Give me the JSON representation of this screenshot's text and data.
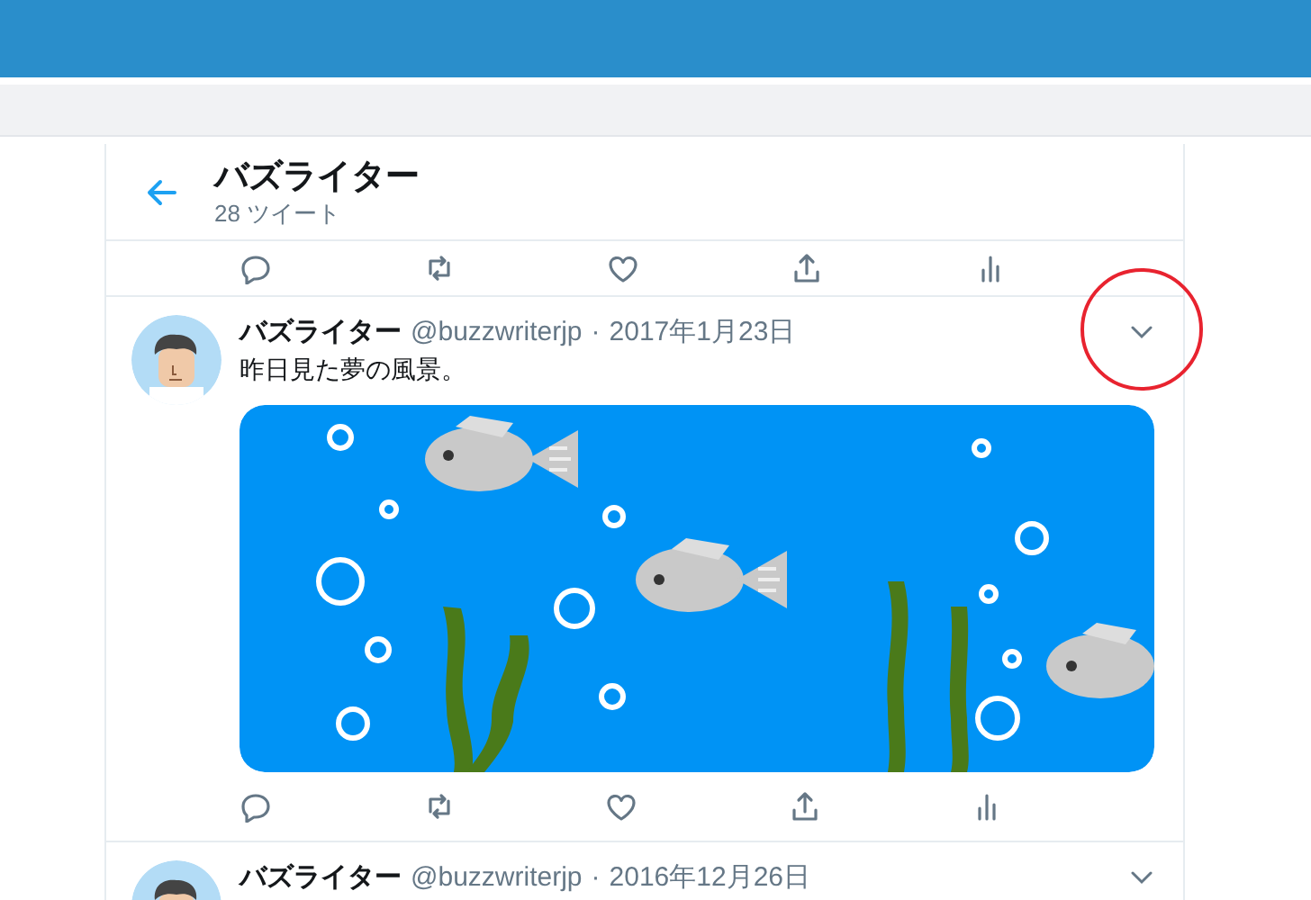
{
  "header": {
    "title": "バズライター",
    "subtitle": "28 ツイート"
  },
  "tweets": [
    {
      "kind": "actions"
    },
    {
      "kind": "full",
      "name": "バズライター",
      "handle": "@buzzwriterjp",
      "separator": "·",
      "date": "2017年1月23日",
      "text": "昨日見た夢の風景。",
      "image": true,
      "highlighted_menu": true
    },
    {
      "kind": "partial",
      "name": "バズライター",
      "handle": "@buzzwriterjp",
      "separator": "·",
      "date": "2016年12月26日",
      "highlighted_menu": false
    }
  ]
}
